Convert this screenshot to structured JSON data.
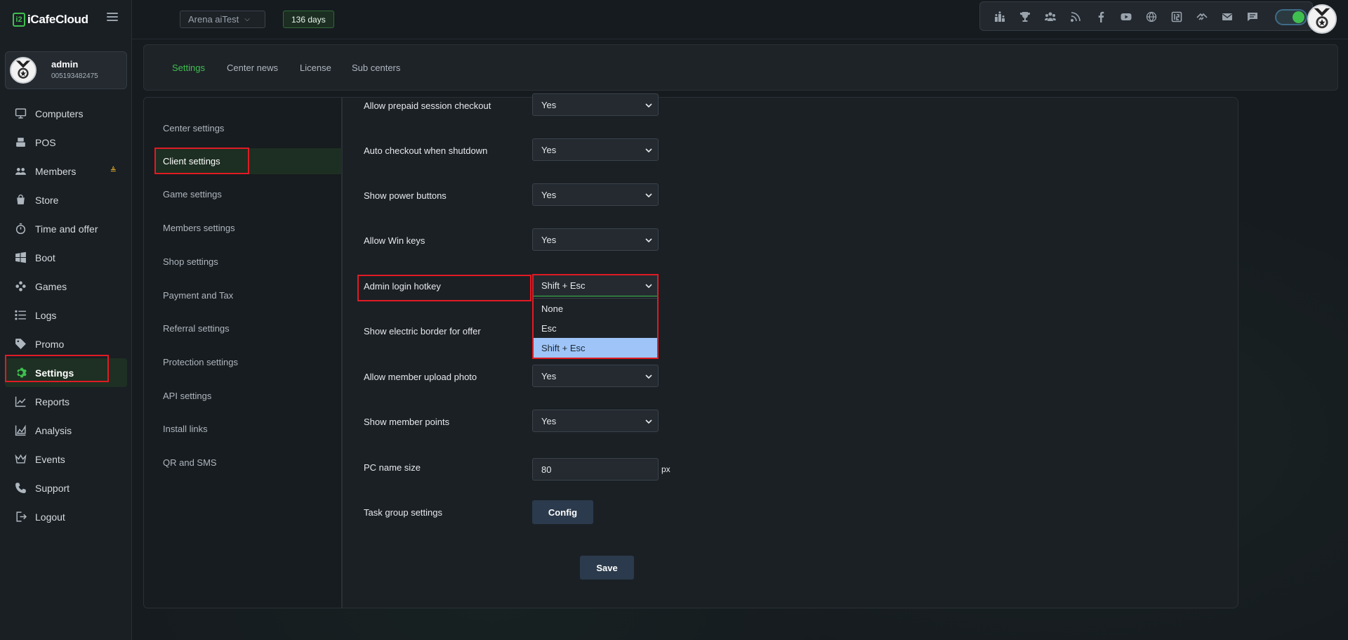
{
  "app": {
    "logo_text": "iCafeCloud",
    "logo_mark": "i2"
  },
  "user": {
    "name": "admin",
    "id": "005193482475"
  },
  "topbar": {
    "center_name": "Arena aiTest",
    "days_badge": "136 days",
    "tray_icons": [
      "leaderboard-icon",
      "trophy-icon",
      "community-icon",
      "rss-icon",
      "facebook-icon",
      "youtube-icon",
      "globe-icon",
      "icafe-icon",
      "handshake-icon",
      "mail-icon",
      "chat-icon"
    ],
    "toggle_on": true
  },
  "sidebar": {
    "items": [
      {
        "label": "Computers",
        "icon": "monitor-icon"
      },
      {
        "label": "POS",
        "icon": "cash-register-icon"
      },
      {
        "label": "Members",
        "icon": "users-icon"
      },
      {
        "label": "Store",
        "icon": "bag-icon"
      },
      {
        "label": "Time and offer",
        "icon": "stopwatch-icon"
      },
      {
        "label": "Boot",
        "icon": "windows-icon"
      },
      {
        "label": "Games",
        "icon": "gamepad-icon"
      },
      {
        "label": "Logs",
        "icon": "list-icon"
      },
      {
        "label": "Promo",
        "icon": "tag-icon"
      },
      {
        "label": "Settings",
        "icon": "gear-icon"
      },
      {
        "label": "Reports",
        "icon": "line-chart-icon"
      },
      {
        "label": "Analysis",
        "icon": "area-chart-icon"
      },
      {
        "label": "Events",
        "icon": "crown-icon"
      },
      {
        "label": "Support",
        "icon": "phone-icon"
      },
      {
        "label": "Logout",
        "icon": "logout-icon"
      }
    ],
    "active": "Settings"
  },
  "tabs": [
    {
      "label": "Settings",
      "active": true
    },
    {
      "label": "Center news",
      "active": false
    },
    {
      "label": "License",
      "active": false
    },
    {
      "label": "Sub centers",
      "active": false
    }
  ],
  "settings_menu": [
    {
      "label": "Center settings"
    },
    {
      "label": "Client settings",
      "active": true
    },
    {
      "label": "Game settings"
    },
    {
      "label": "Members settings"
    },
    {
      "label": "Shop settings"
    },
    {
      "label": "Payment and Tax"
    },
    {
      "label": "Referral settings"
    },
    {
      "label": "Protection settings"
    },
    {
      "label": "API settings"
    },
    {
      "label": "Install links"
    },
    {
      "label": "QR and SMS"
    }
  ],
  "form": {
    "rows": [
      {
        "label": "Allow prepaid session checkout",
        "value": "Yes"
      },
      {
        "label": "Auto checkout when shutdown",
        "value": "Yes"
      },
      {
        "label": "Show power buttons",
        "value": "Yes"
      },
      {
        "label": "Allow Win keys",
        "value": "Yes"
      },
      {
        "label": "Admin login hotkey",
        "value": "Shift + Esc"
      },
      {
        "label": "Show electric border for offer",
        "value": ""
      },
      {
        "label": "Allow member upload photo",
        "value": "Yes"
      },
      {
        "label": "Show member points",
        "value": "Yes"
      }
    ],
    "hotkey_options": [
      "None",
      "Esc",
      "Shift + Esc"
    ],
    "hotkey_selected": "Shift + Esc",
    "pc_name_size": {
      "label": "PC name size",
      "value": "80",
      "unit": "px"
    },
    "task_group": {
      "label": "Task group settings",
      "button": "Config"
    },
    "save_button": "Save"
  }
}
